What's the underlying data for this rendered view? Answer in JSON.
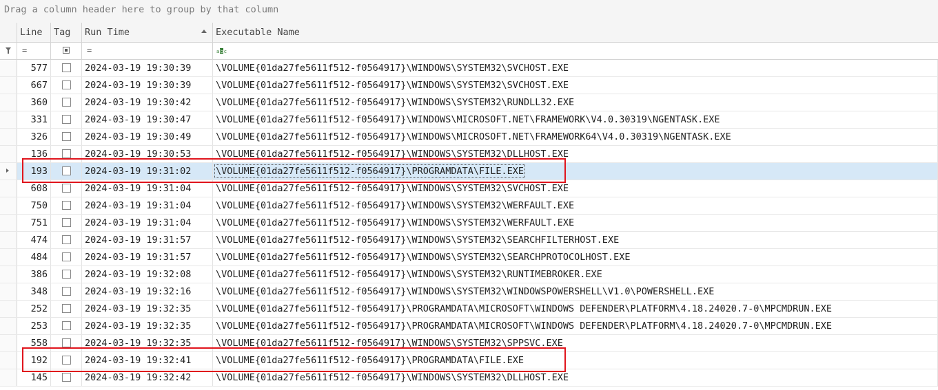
{
  "group_panel": {
    "hint": "Drag a column header here to group by that column"
  },
  "columns": {
    "line": "Line",
    "tag": "Tag",
    "run_time": "Run Time",
    "executable_name": "Executable Name"
  },
  "sort": {
    "column": "run_time",
    "direction": "ascending"
  },
  "filter_row": {
    "line_operator": "=",
    "run_time_operator": "=",
    "executable_icon": "text-filter-icon"
  },
  "selected_row_index": 6,
  "highlighted_row_indices": [
    6,
    17
  ],
  "highlight_color": "#e0141c",
  "selection_color": "#d6e8f7",
  "rows": [
    {
      "line": "577",
      "run_time": "2024-03-19 19:30:39",
      "exe": "\\VOLUME{01da27fe5611f512-f0564917}\\WINDOWS\\SYSTEM32\\SVCHOST.EXE"
    },
    {
      "line": "667",
      "run_time": "2024-03-19 19:30:39",
      "exe": "\\VOLUME{01da27fe5611f512-f0564917}\\WINDOWS\\SYSTEM32\\SVCHOST.EXE"
    },
    {
      "line": "360",
      "run_time": "2024-03-19 19:30:42",
      "exe": "\\VOLUME{01da27fe5611f512-f0564917}\\WINDOWS\\SYSTEM32\\RUNDLL32.EXE"
    },
    {
      "line": "331",
      "run_time": "2024-03-19 19:30:47",
      "exe": "\\VOLUME{01da27fe5611f512-f0564917}\\WINDOWS\\MICROSOFT.NET\\FRAMEWORK\\V4.0.30319\\NGENTASK.EXE"
    },
    {
      "line": "326",
      "run_time": "2024-03-19 19:30:49",
      "exe": "\\VOLUME{01da27fe5611f512-f0564917}\\WINDOWS\\MICROSOFT.NET\\FRAMEWORK64\\V4.0.30319\\NGENTASK.EXE"
    },
    {
      "line": "136",
      "run_time": "2024-03-19 19:30:53",
      "exe": "\\VOLUME{01da27fe5611f512-f0564917}\\WINDOWS\\SYSTEM32\\DLLHOST.EXE"
    },
    {
      "line": "193",
      "run_time": "2024-03-19 19:31:02",
      "exe": "\\VOLUME{01da27fe5611f512-f0564917}\\PROGRAMDATA\\FILE.EXE"
    },
    {
      "line": "608",
      "run_time": "2024-03-19 19:31:04",
      "exe": "\\VOLUME{01da27fe5611f512-f0564917}\\WINDOWS\\SYSTEM32\\SVCHOST.EXE"
    },
    {
      "line": "750",
      "run_time": "2024-03-19 19:31:04",
      "exe": "\\VOLUME{01da27fe5611f512-f0564917}\\WINDOWS\\SYSTEM32\\WERFAULT.EXE"
    },
    {
      "line": "751",
      "run_time": "2024-03-19 19:31:04",
      "exe": "\\VOLUME{01da27fe5611f512-f0564917}\\WINDOWS\\SYSTEM32\\WERFAULT.EXE"
    },
    {
      "line": "474",
      "run_time": "2024-03-19 19:31:57",
      "exe": "\\VOLUME{01da27fe5611f512-f0564917}\\WINDOWS\\SYSTEM32\\SEARCHFILTERHOST.EXE"
    },
    {
      "line": "484",
      "run_time": "2024-03-19 19:31:57",
      "exe": "\\VOLUME{01da27fe5611f512-f0564917}\\WINDOWS\\SYSTEM32\\SEARCHPROTOCOLHOST.EXE"
    },
    {
      "line": "386",
      "run_time": "2024-03-19 19:32:08",
      "exe": "\\VOLUME{01da27fe5611f512-f0564917}\\WINDOWS\\SYSTEM32\\RUNTIMEBROKER.EXE"
    },
    {
      "line": "348",
      "run_time": "2024-03-19 19:32:16",
      "exe": "\\VOLUME{01da27fe5611f512-f0564917}\\WINDOWS\\SYSTEM32\\WINDOWSPOWERSHELL\\V1.0\\POWERSHELL.EXE"
    },
    {
      "line": "252",
      "run_time": "2024-03-19 19:32:35",
      "exe": "\\VOLUME{01da27fe5611f512-f0564917}\\PROGRAMDATA\\MICROSOFT\\WINDOWS DEFENDER\\PLATFORM\\4.18.24020.7-0\\MPCMDRUN.EXE"
    },
    {
      "line": "253",
      "run_time": "2024-03-19 19:32:35",
      "exe": "\\VOLUME{01da27fe5611f512-f0564917}\\PROGRAMDATA\\MICROSOFT\\WINDOWS DEFENDER\\PLATFORM\\4.18.24020.7-0\\MPCMDRUN.EXE"
    },
    {
      "line": "558",
      "run_time": "2024-03-19 19:32:35",
      "exe": "\\VOLUME{01da27fe5611f512-f0564917}\\WINDOWS\\SYSTEM32\\SPPSVC.EXE"
    },
    {
      "line": "192",
      "run_time": "2024-03-19 19:32:41",
      "exe": "\\VOLUME{01da27fe5611f512-f0564917}\\PROGRAMDATA\\FILE.EXE"
    },
    {
      "line": "145",
      "run_time": "2024-03-19 19:32:42",
      "exe": "\\VOLUME{01da27fe5611f512-f0564917}\\WINDOWS\\SYSTEM32\\DLLHOST.EXE"
    }
  ]
}
